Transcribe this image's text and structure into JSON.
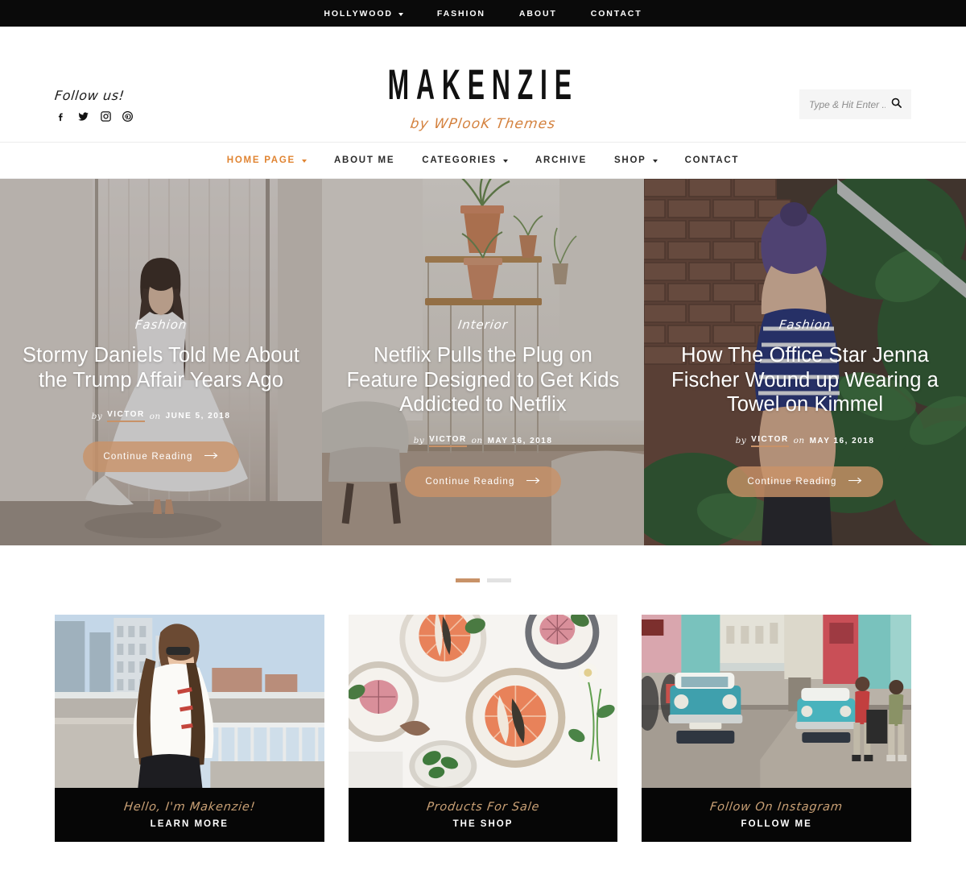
{
  "topbar": {
    "items": [
      {
        "label": "HOLLYWOOD",
        "has_caret": true
      },
      {
        "label": "FASHION",
        "has_caret": false
      },
      {
        "label": "ABOUT",
        "has_caret": false
      },
      {
        "label": "CONTACT",
        "has_caret": false
      }
    ]
  },
  "header": {
    "follow_label": "Follow us!",
    "social": [
      {
        "name": "facebook-icon"
      },
      {
        "name": "twitter-icon"
      },
      {
        "name": "instagram-icon"
      },
      {
        "name": "pinterest-icon"
      }
    ],
    "brand_name": "MAKENZIE",
    "brand_sub": "by WPlooK Themes",
    "search_placeholder": "Type & Hit Enter ...",
    "search_value": ""
  },
  "mainnav": {
    "items": [
      {
        "label": "HOME PAGE",
        "has_caret": true,
        "active": true
      },
      {
        "label": "ABOUT ME",
        "has_caret": false,
        "active": false
      },
      {
        "label": "CATEGORIES",
        "has_caret": true,
        "active": false
      },
      {
        "label": "ARCHIVE",
        "has_caret": false,
        "active": false
      },
      {
        "label": "SHOP",
        "has_caret": true,
        "active": false
      },
      {
        "label": "CONTACT",
        "has_caret": false,
        "active": false
      }
    ]
  },
  "slider": {
    "slides": [
      {
        "category": "Fashion",
        "title": "Stormy Daniels Told Me About the Trump Affair Years Ago",
        "by_label": "by",
        "author": "VICTOR",
        "on_label": "on",
        "date": "JUNE 5, 2018",
        "cta": "Continue Reading",
        "image_alt": "woman in white dress against wall"
      },
      {
        "category": "Interior",
        "title": "Netflix Pulls the Plug on Feature Designed to Get Kids Addicted to Netflix",
        "by_label": "by",
        "author": "VICTOR",
        "on_label": "on",
        "date": "MAY 16, 2018",
        "cta": "Continue Reading",
        "image_alt": "potted plants on wooden shelf"
      },
      {
        "category": "Fashion",
        "title": "How The Office Star Jenna Fischer Wound up Wearing a Towel on Kimmel",
        "by_label": "by",
        "author": "VICTOR",
        "on_label": "on",
        "date": "MAY 16, 2018",
        "cta": "Continue Reading",
        "image_alt": "woman in striped shirt by brick wall"
      }
    ],
    "pagination": [
      {
        "active": true
      },
      {
        "active": false
      }
    ]
  },
  "promos": [
    {
      "script": "Hello, I'm Makenzie!",
      "cta": "LEARN MORE",
      "image_alt": "woman in white jacket on city rooftop"
    },
    {
      "script": "Products For Sale",
      "cta": "THE SHOP",
      "image_alt": "grapefruit and fig plates flat lay"
    },
    {
      "script": "Follow On Instagram",
      "cta": "FOLLOW ME",
      "image_alt": "vintage cars on a Havana street"
    }
  ],
  "colors": {
    "accent_orange": "#e08432",
    "accent_tan": "#c89268",
    "script_tan": "#c9a075",
    "dark": "#0a0a0a"
  }
}
